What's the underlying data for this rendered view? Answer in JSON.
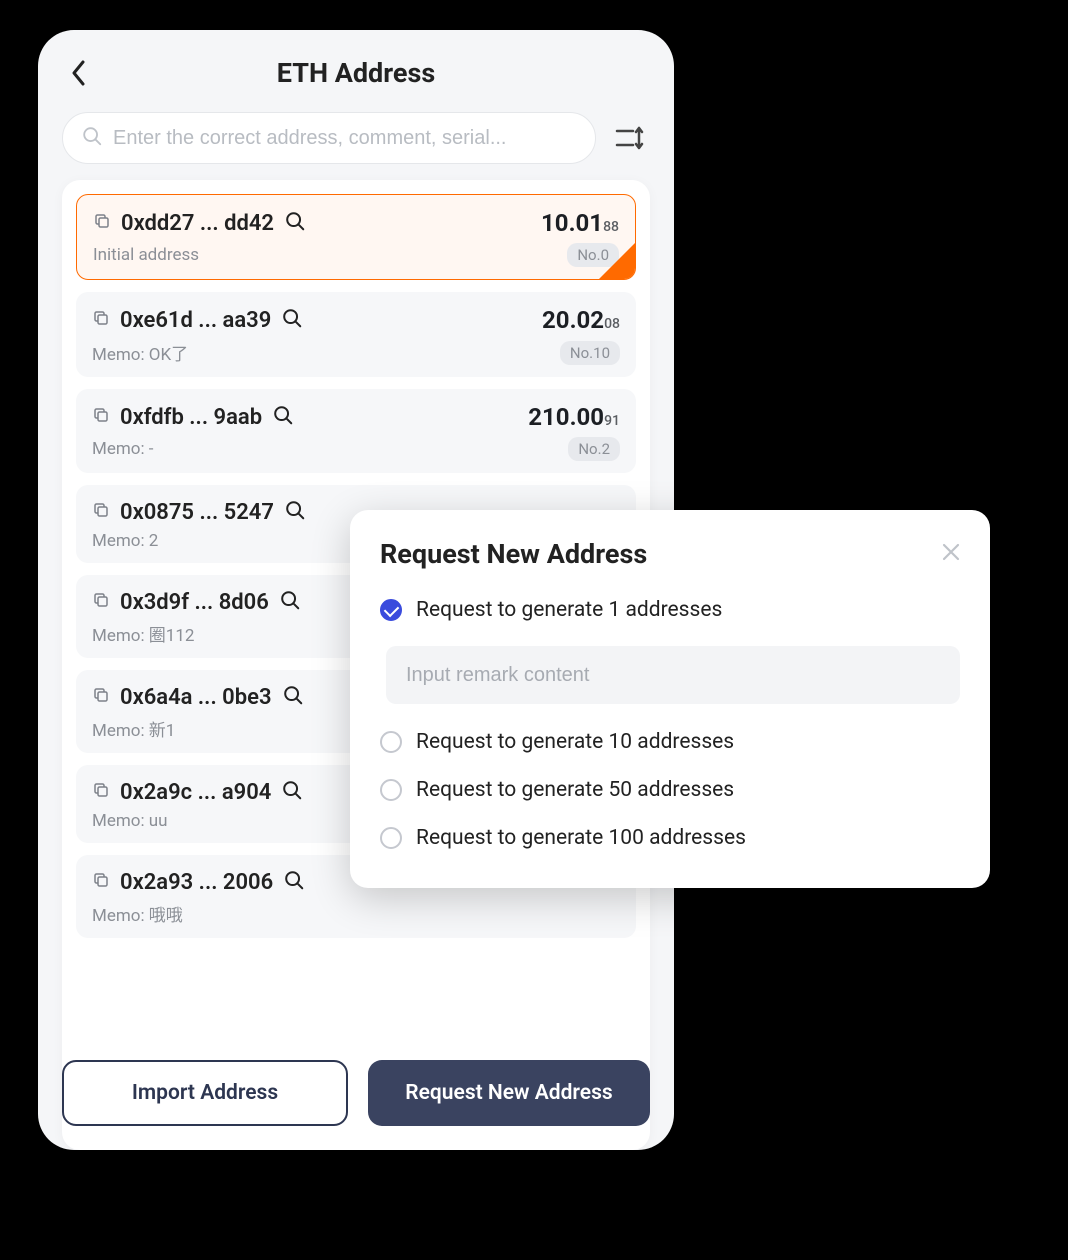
{
  "header": {
    "title": "ETH Address"
  },
  "search": {
    "placeholder": "Enter the correct address, comment, serial..."
  },
  "addresses": [
    {
      "addr": "0xdd27 ... dd42",
      "balance_main": "10.01",
      "balance_sub": "88",
      "memo": "Initial address",
      "no": "No.0",
      "selected": true
    },
    {
      "addr": "0xe61d ... aa39",
      "balance_main": "20.02",
      "balance_sub": "08",
      "memo": "Memo: OK了",
      "no": "No.10",
      "selected": false
    },
    {
      "addr": "0xfdfb ... 9aab",
      "balance_main": "210.00",
      "balance_sub": "91",
      "memo": "Memo: -",
      "no": "No.2",
      "selected": false
    },
    {
      "addr": "0x0875 ... 5247",
      "balance_main": "",
      "balance_sub": "",
      "memo": "Memo: 2",
      "no": "",
      "selected": false
    },
    {
      "addr": "0x3d9f ... 8d06",
      "balance_main": "",
      "balance_sub": "",
      "memo": "Memo: 圈112",
      "no": "",
      "selected": false
    },
    {
      "addr": "0x6a4a ... 0be3",
      "balance_main": "",
      "balance_sub": "",
      "memo": "Memo: 新1",
      "no": "",
      "selected": false
    },
    {
      "addr": "0x2a9c ... a904",
      "balance_main": "",
      "balance_sub": "",
      "memo": "Memo: uu",
      "no": "",
      "selected": false
    },
    {
      "addr": "0x2a93 ... 2006",
      "balance_main": "",
      "balance_sub": "",
      "memo": "Memo: 哦哦",
      "no": "",
      "selected": false
    }
  ],
  "footer": {
    "import_label": "Import Address",
    "request_label": "Request New Address"
  },
  "modal": {
    "title": "Request New Address",
    "remark_placeholder": "Input remark content",
    "options": [
      {
        "label": "Request to generate 1 addresses",
        "checked": true
      },
      {
        "label": "Request to generate 10 addresses",
        "checked": false
      },
      {
        "label": "Request to generate 50 addresses",
        "checked": false
      },
      {
        "label": "Request to generate 100 addresses",
        "checked": false
      }
    ]
  }
}
